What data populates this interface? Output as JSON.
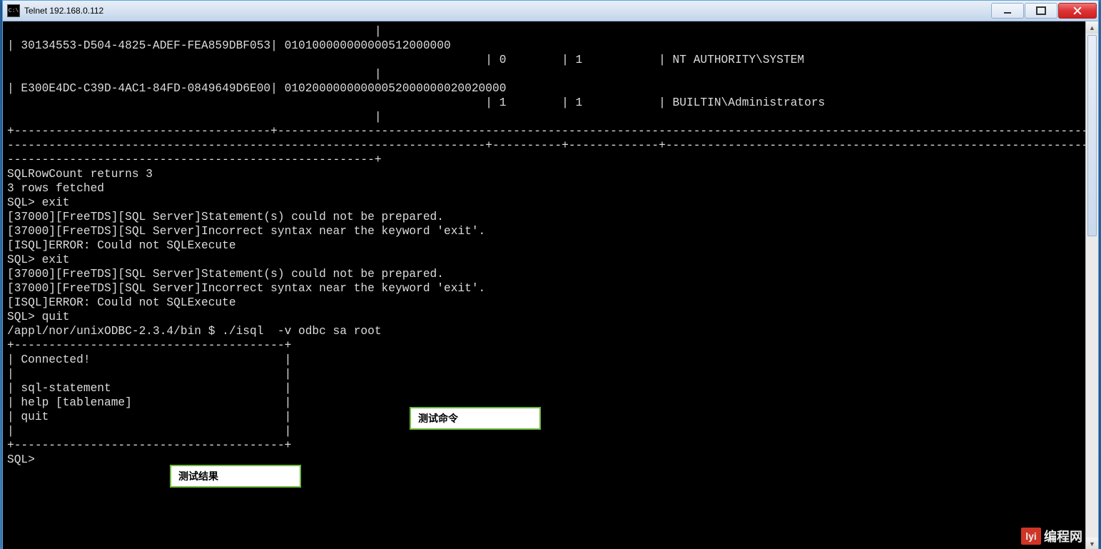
{
  "window": {
    "title": "Telnet 192.168.0.112",
    "icon_label": "C:\\"
  },
  "terminal_lines": [
    "                                                     |",
    "| 30134553-D504-4825-ADEF-FEA859DBF053| 010100000000000512000000",
    "                                                                     | 0        | 1           | NT AUTHORITY\\SYSTEM",
    "                                                     |",
    "| E300E4DC-C39D-4AC1-84FD-0849649D6E00| 01020000000000052000000020020000",
    "                                                                     | 1        | 1           | BUILTIN\\Administrators",
    "                                                     |",
    "+-------------------------------------+-----------------------------------------------------------------------------------------------------------------------",
    "---------------------------------------------------------------------+----------+-------------+-------------------------------------------------------------",
    "-----------------------------------------------------+",
    "SQLRowCount returns 3",
    "3 rows fetched",
    "SQL> exit",
    "[37000][FreeTDS][SQL Server]Statement(s) could not be prepared.",
    "[37000][FreeTDS][SQL Server]Incorrect syntax near the keyword 'exit'.",
    "[ISQL]ERROR: Could not SQLExecute",
    "SQL> exit",
    "[37000][FreeTDS][SQL Server]Statement(s) could not be prepared.",
    "[37000][FreeTDS][SQL Server]Incorrect syntax near the keyword 'exit'.",
    "[ISQL]ERROR: Could not SQLExecute",
    "SQL> quit",
    "/appl/nor/unixODBC-2.3.4/bin $ ./isql  -v odbc sa root",
    "+---------------------------------------+",
    "| Connected!                            |",
    "|                                       |",
    "| sql-statement                         |",
    "| help [tablename]                      |",
    "| quit                                  |",
    "|                                       |",
    "+---------------------------------------+",
    "SQL>"
  ],
  "callouts": {
    "cmd": "测试命令",
    "result": "测试结果"
  },
  "watermark": {
    "logo": "lyi",
    "text": "编程网"
  },
  "win_buttons": {
    "min": "minimize",
    "max": "maximize",
    "close": "close"
  }
}
